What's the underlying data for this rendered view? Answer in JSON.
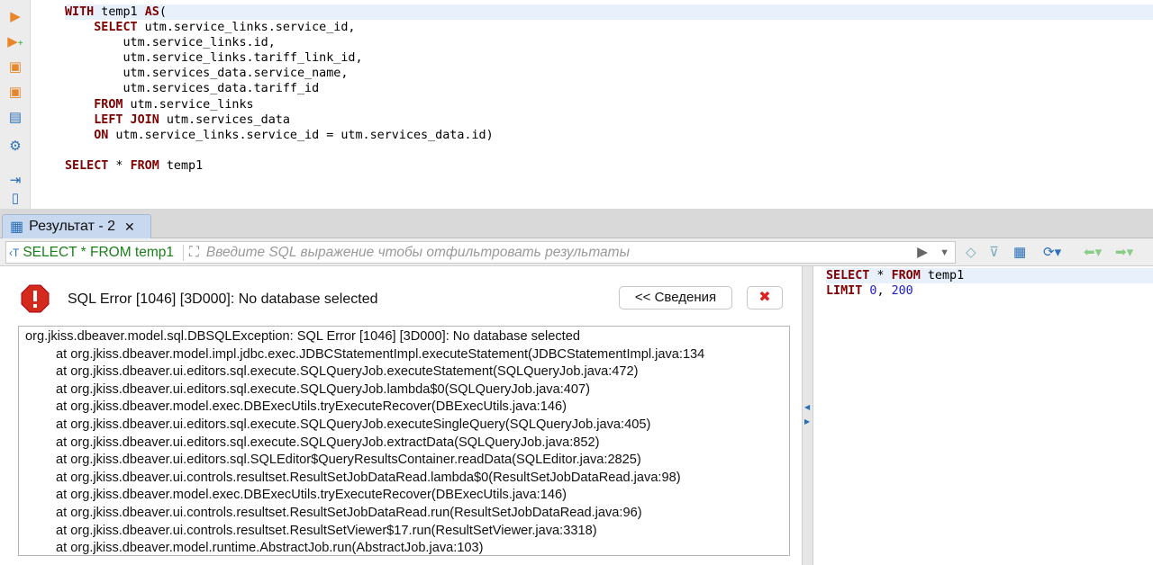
{
  "editor": {
    "lines": [
      [
        {
          "t": "WITH",
          "k": 1
        },
        {
          "t": " temp1 "
        },
        {
          "t": "AS",
          "k": 1
        },
        {
          "t": "("
        }
      ],
      [
        {
          "t": "    "
        },
        {
          "t": "SELECT",
          "k": 1
        },
        {
          "t": " utm.service_links.service_id,"
        }
      ],
      [
        {
          "t": "        utm.service_links.id,"
        }
      ],
      [
        {
          "t": "        utm.service_links.tariff_link_id,"
        }
      ],
      [
        {
          "t": "        utm.services_data.service_name,"
        }
      ],
      [
        {
          "t": "        utm.services_data.tariff_id"
        }
      ],
      [
        {
          "t": "    "
        },
        {
          "t": "FROM",
          "k": 1
        },
        {
          "t": " utm.service_links"
        }
      ],
      [
        {
          "t": "    "
        },
        {
          "t": "LEFT JOIN",
          "k": 1
        },
        {
          "t": " utm.services_data"
        }
      ],
      [
        {
          "t": "    "
        },
        {
          "t": "ON",
          "k": 1
        },
        {
          "t": " utm.service_links.service_id = utm.services_data.id)"
        }
      ],
      [
        {
          "t": ""
        }
      ],
      [
        {
          "t": "SELECT",
          "k": 1
        },
        {
          "t": " * "
        },
        {
          "t": "FROM",
          "k": 1
        },
        {
          "t": " temp1"
        }
      ]
    ]
  },
  "results_tab": {
    "label": "Результат - 2",
    "close": "✕"
  },
  "filter": {
    "query": "SELECT * FROM temp1",
    "placeholder": "Введите SQL выражение чтобы отфильтровать результаты"
  },
  "error": {
    "message": "SQL Error [1046] [3D000]: No database selected",
    "details_button": "<< Сведения",
    "trace": [
      "org.jkiss.dbeaver.model.sql.DBSQLException: SQL Error [1046] [3D000]: No database selected",
      "at org.jkiss.dbeaver.model.impl.jdbc.exec.JDBCStatementImpl.executeStatement(JDBCStatementImpl.java:134",
      "at org.jkiss.dbeaver.ui.editors.sql.execute.SQLQueryJob.executeStatement(SQLQueryJob.java:472)",
      "at org.jkiss.dbeaver.ui.editors.sql.execute.SQLQueryJob.lambda$0(SQLQueryJob.java:407)",
      "at org.jkiss.dbeaver.model.exec.DBExecUtils.tryExecuteRecover(DBExecUtils.java:146)",
      "at org.jkiss.dbeaver.ui.editors.sql.execute.SQLQueryJob.executeSingleQuery(SQLQueryJob.java:405)",
      "at org.jkiss.dbeaver.ui.editors.sql.execute.SQLQueryJob.extractData(SQLQueryJob.java:852)",
      "at org.jkiss.dbeaver.ui.editors.sql.SQLEditor$QueryResultsContainer.readData(SQLEditor.java:2825)",
      "at org.jkiss.dbeaver.ui.controls.resultset.ResultSetJobDataRead.lambda$0(ResultSetJobDataRead.java:98)",
      "at org.jkiss.dbeaver.model.exec.DBExecUtils.tryExecuteRecover(DBExecUtils.java:146)",
      "at org.jkiss.dbeaver.ui.controls.resultset.ResultSetJobDataRead.run(ResultSetJobDataRead.java:96)",
      "at org.jkiss.dbeaver.ui.controls.resultset.ResultSetViewer$17.run(ResultSetViewer.java:3318)",
      "at org.jkiss.dbeaver.model.runtime.AbstractJob.run(AbstractJob.java:103)"
    ]
  },
  "executed_sql": {
    "lines": [
      [
        {
          "t": "SELECT",
          "k": 1
        },
        {
          "t": " * "
        },
        {
          "t": "FROM",
          "k": 1
        },
        {
          "t": " temp1"
        }
      ],
      [
        {
          "t": "LIMIT",
          "k": 1
        },
        {
          "t": " "
        },
        {
          "t": "0",
          "n": 1
        },
        {
          "t": ", "
        },
        {
          "t": "200",
          "n": 1
        }
      ]
    ]
  }
}
